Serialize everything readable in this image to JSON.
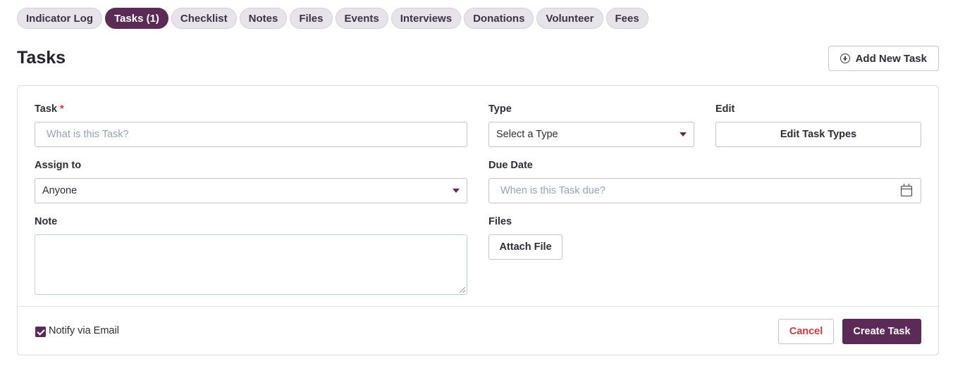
{
  "tabs": [
    {
      "label": "Indicator Log",
      "active": false
    },
    {
      "label": "Tasks (1)",
      "active": true
    },
    {
      "label": "Checklist",
      "active": false
    },
    {
      "label": "Notes",
      "active": false
    },
    {
      "label": "Files",
      "active": false
    },
    {
      "label": "Events",
      "active": false
    },
    {
      "label": "Interviews",
      "active": false
    },
    {
      "label": "Donations",
      "active": false
    },
    {
      "label": "Volunteer",
      "active": false
    },
    {
      "label": "Fees",
      "active": false
    }
  ],
  "header": {
    "title": "Tasks",
    "add_button_label": "Add New Task",
    "add_button_icon": "plus-circle-icon"
  },
  "form": {
    "task": {
      "label": "Task",
      "required_marker": "*",
      "placeholder": "What is this Task?"
    },
    "type": {
      "label": "Type",
      "selected": "Select a Type"
    },
    "edit": {
      "label": "Edit",
      "button_label": "Edit Task Types"
    },
    "assign_to": {
      "label": "Assign to",
      "selected": "Anyone"
    },
    "due_date": {
      "label": "Due Date",
      "placeholder": "When is this Task due?",
      "icon": "calendar-icon"
    },
    "note": {
      "label": "Note",
      "value": ""
    },
    "files": {
      "label": "Files",
      "button_label": "Attach File"
    }
  },
  "footer": {
    "notify_label": "Notify via Email",
    "notify_checked": true,
    "cancel_label": "Cancel",
    "create_label": "Create Task"
  },
  "colors": {
    "accent": "#5b2a57",
    "danger": "#d0393e",
    "placeholder": "#93a4bd",
    "tab_bg": "#e8e3ea"
  }
}
